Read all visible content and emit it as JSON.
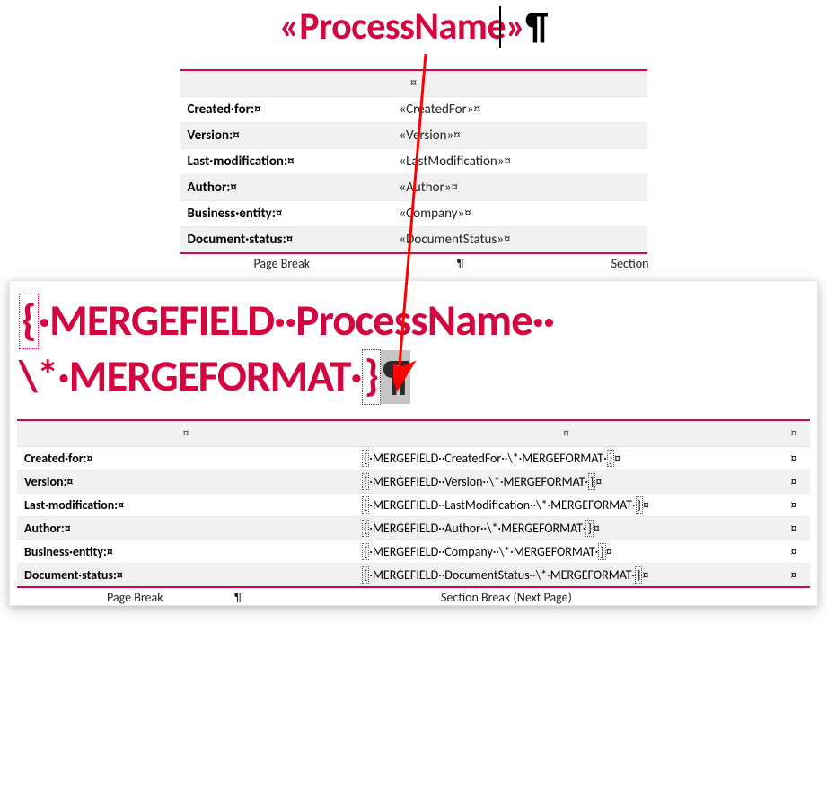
{
  "formatting": {
    "cell_mark": "¤",
    "pilcrow": "¶",
    "dot": "·"
  },
  "top": {
    "title": "«ProcessName»",
    "rows": [
      {
        "label": "Created·for:¤",
        "value": "«CreatedFor»¤"
      },
      {
        "label": "Version:¤",
        "value": "«Version»¤"
      },
      {
        "label": "Last·modification:¤",
        "value": "«LastModification»¤"
      },
      {
        "label": "Author:¤",
        "value": "«Author»¤"
      },
      {
        "label": "Business·entity:¤",
        "value": "«Company»¤"
      },
      {
        "label": "Document·status:¤",
        "value": "«DocumentStatus»¤"
      }
    ],
    "page_break": "Page Break",
    "section_break_partial": "Section"
  },
  "bottom": {
    "field_code_line1": "{·MERGEFIELD··ProcessName··",
    "field_code_line2_a": "\\*·MERGEFORMAT·",
    "field_code_line2_brace": "}",
    "rows": [
      {
        "label": "Created·for:¤",
        "code": "{·MERGEFIELD··CreatedFor··\\*·MERGEFORMAT·}¤"
      },
      {
        "label": "Version:¤",
        "code": "{·MERGEFIELD··Version··\\*·MERGEFORMAT·}¤"
      },
      {
        "label": "Last·modification:¤",
        "code": "{·MERGEFIELD··LastModification··\\*·MERGEFORMAT·}¤"
      },
      {
        "label": "Author:¤",
        "code": "{·MERGEFIELD··Author··\\*·MERGEFORMAT·}¤"
      },
      {
        "label": "Business·entity:¤",
        "code": "{·MERGEFIELD··Company··\\*·MERGEFORMAT·}¤"
      },
      {
        "label": "Document·status:¤",
        "code": "{·MERGEFIELD··DocumentStatus··\\*·MERGEFORMAT·}¤"
      }
    ],
    "page_break": "Page Break",
    "section_break": "Section Break (Next Page)"
  },
  "colors": {
    "accent": "#d3063f"
  }
}
